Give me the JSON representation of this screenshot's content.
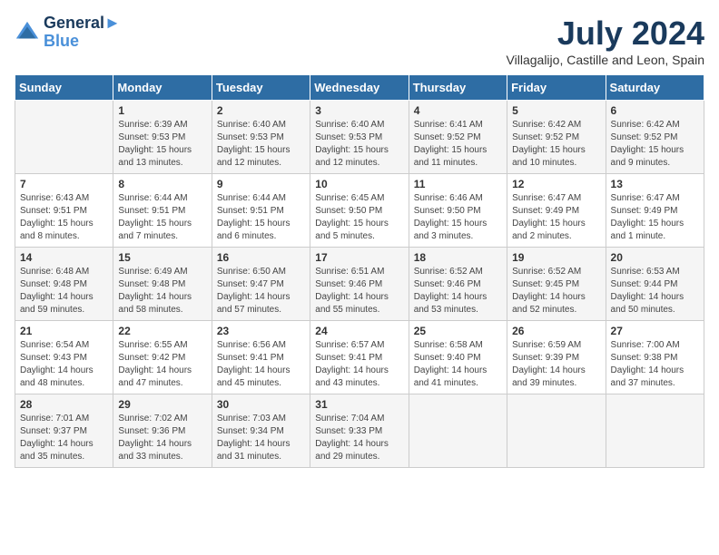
{
  "logo": {
    "line1": "General",
    "line2": "Blue"
  },
  "title": "July 2024",
  "subtitle": "Villagalijo, Castille and Leon, Spain",
  "headers": [
    "Sunday",
    "Monday",
    "Tuesday",
    "Wednesday",
    "Thursday",
    "Friday",
    "Saturday"
  ],
  "weeks": [
    [
      {
        "day": "",
        "sunrise": "",
        "sunset": "",
        "daylight": ""
      },
      {
        "day": "1",
        "sunrise": "Sunrise: 6:39 AM",
        "sunset": "Sunset: 9:53 PM",
        "daylight": "Daylight: 15 hours and 13 minutes."
      },
      {
        "day": "2",
        "sunrise": "Sunrise: 6:40 AM",
        "sunset": "Sunset: 9:53 PM",
        "daylight": "Daylight: 15 hours and 12 minutes."
      },
      {
        "day": "3",
        "sunrise": "Sunrise: 6:40 AM",
        "sunset": "Sunset: 9:53 PM",
        "daylight": "Daylight: 15 hours and 12 minutes."
      },
      {
        "day": "4",
        "sunrise": "Sunrise: 6:41 AM",
        "sunset": "Sunset: 9:52 PM",
        "daylight": "Daylight: 15 hours and 11 minutes."
      },
      {
        "day": "5",
        "sunrise": "Sunrise: 6:42 AM",
        "sunset": "Sunset: 9:52 PM",
        "daylight": "Daylight: 15 hours and 10 minutes."
      },
      {
        "day": "6",
        "sunrise": "Sunrise: 6:42 AM",
        "sunset": "Sunset: 9:52 PM",
        "daylight": "Daylight: 15 hours and 9 minutes."
      }
    ],
    [
      {
        "day": "7",
        "sunrise": "Sunrise: 6:43 AM",
        "sunset": "Sunset: 9:51 PM",
        "daylight": "Daylight: 15 hours and 8 minutes."
      },
      {
        "day": "8",
        "sunrise": "Sunrise: 6:44 AM",
        "sunset": "Sunset: 9:51 PM",
        "daylight": "Daylight: 15 hours and 7 minutes."
      },
      {
        "day": "9",
        "sunrise": "Sunrise: 6:44 AM",
        "sunset": "Sunset: 9:51 PM",
        "daylight": "Daylight: 15 hours and 6 minutes."
      },
      {
        "day": "10",
        "sunrise": "Sunrise: 6:45 AM",
        "sunset": "Sunset: 9:50 PM",
        "daylight": "Daylight: 15 hours and 5 minutes."
      },
      {
        "day": "11",
        "sunrise": "Sunrise: 6:46 AM",
        "sunset": "Sunset: 9:50 PM",
        "daylight": "Daylight: 15 hours and 3 minutes."
      },
      {
        "day": "12",
        "sunrise": "Sunrise: 6:47 AM",
        "sunset": "Sunset: 9:49 PM",
        "daylight": "Daylight: 15 hours and 2 minutes."
      },
      {
        "day": "13",
        "sunrise": "Sunrise: 6:47 AM",
        "sunset": "Sunset: 9:49 PM",
        "daylight": "Daylight: 15 hours and 1 minute."
      }
    ],
    [
      {
        "day": "14",
        "sunrise": "Sunrise: 6:48 AM",
        "sunset": "Sunset: 9:48 PM",
        "daylight": "Daylight: 14 hours and 59 minutes."
      },
      {
        "day": "15",
        "sunrise": "Sunrise: 6:49 AM",
        "sunset": "Sunset: 9:48 PM",
        "daylight": "Daylight: 14 hours and 58 minutes."
      },
      {
        "day": "16",
        "sunrise": "Sunrise: 6:50 AM",
        "sunset": "Sunset: 9:47 PM",
        "daylight": "Daylight: 14 hours and 57 minutes."
      },
      {
        "day": "17",
        "sunrise": "Sunrise: 6:51 AM",
        "sunset": "Sunset: 9:46 PM",
        "daylight": "Daylight: 14 hours and 55 minutes."
      },
      {
        "day": "18",
        "sunrise": "Sunrise: 6:52 AM",
        "sunset": "Sunset: 9:46 PM",
        "daylight": "Daylight: 14 hours and 53 minutes."
      },
      {
        "day": "19",
        "sunrise": "Sunrise: 6:52 AM",
        "sunset": "Sunset: 9:45 PM",
        "daylight": "Daylight: 14 hours and 52 minutes."
      },
      {
        "day": "20",
        "sunrise": "Sunrise: 6:53 AM",
        "sunset": "Sunset: 9:44 PM",
        "daylight": "Daylight: 14 hours and 50 minutes."
      }
    ],
    [
      {
        "day": "21",
        "sunrise": "Sunrise: 6:54 AM",
        "sunset": "Sunset: 9:43 PM",
        "daylight": "Daylight: 14 hours and 48 minutes."
      },
      {
        "day": "22",
        "sunrise": "Sunrise: 6:55 AM",
        "sunset": "Sunset: 9:42 PM",
        "daylight": "Daylight: 14 hours and 47 minutes."
      },
      {
        "day": "23",
        "sunrise": "Sunrise: 6:56 AM",
        "sunset": "Sunset: 9:41 PM",
        "daylight": "Daylight: 14 hours and 45 minutes."
      },
      {
        "day": "24",
        "sunrise": "Sunrise: 6:57 AM",
        "sunset": "Sunset: 9:41 PM",
        "daylight": "Daylight: 14 hours and 43 minutes."
      },
      {
        "day": "25",
        "sunrise": "Sunrise: 6:58 AM",
        "sunset": "Sunset: 9:40 PM",
        "daylight": "Daylight: 14 hours and 41 minutes."
      },
      {
        "day": "26",
        "sunrise": "Sunrise: 6:59 AM",
        "sunset": "Sunset: 9:39 PM",
        "daylight": "Daylight: 14 hours and 39 minutes."
      },
      {
        "day": "27",
        "sunrise": "Sunrise: 7:00 AM",
        "sunset": "Sunset: 9:38 PM",
        "daylight": "Daylight: 14 hours and 37 minutes."
      }
    ],
    [
      {
        "day": "28",
        "sunrise": "Sunrise: 7:01 AM",
        "sunset": "Sunset: 9:37 PM",
        "daylight": "Daylight: 14 hours and 35 minutes."
      },
      {
        "day": "29",
        "sunrise": "Sunrise: 7:02 AM",
        "sunset": "Sunset: 9:36 PM",
        "daylight": "Daylight: 14 hours and 33 minutes."
      },
      {
        "day": "30",
        "sunrise": "Sunrise: 7:03 AM",
        "sunset": "Sunset: 9:34 PM",
        "daylight": "Daylight: 14 hours and 31 minutes."
      },
      {
        "day": "31",
        "sunrise": "Sunrise: 7:04 AM",
        "sunset": "Sunset: 9:33 PM",
        "daylight": "Daylight: 14 hours and 29 minutes."
      },
      {
        "day": "",
        "sunrise": "",
        "sunset": "",
        "daylight": ""
      },
      {
        "day": "",
        "sunrise": "",
        "sunset": "",
        "daylight": ""
      },
      {
        "day": "",
        "sunrise": "",
        "sunset": "",
        "daylight": ""
      }
    ]
  ]
}
